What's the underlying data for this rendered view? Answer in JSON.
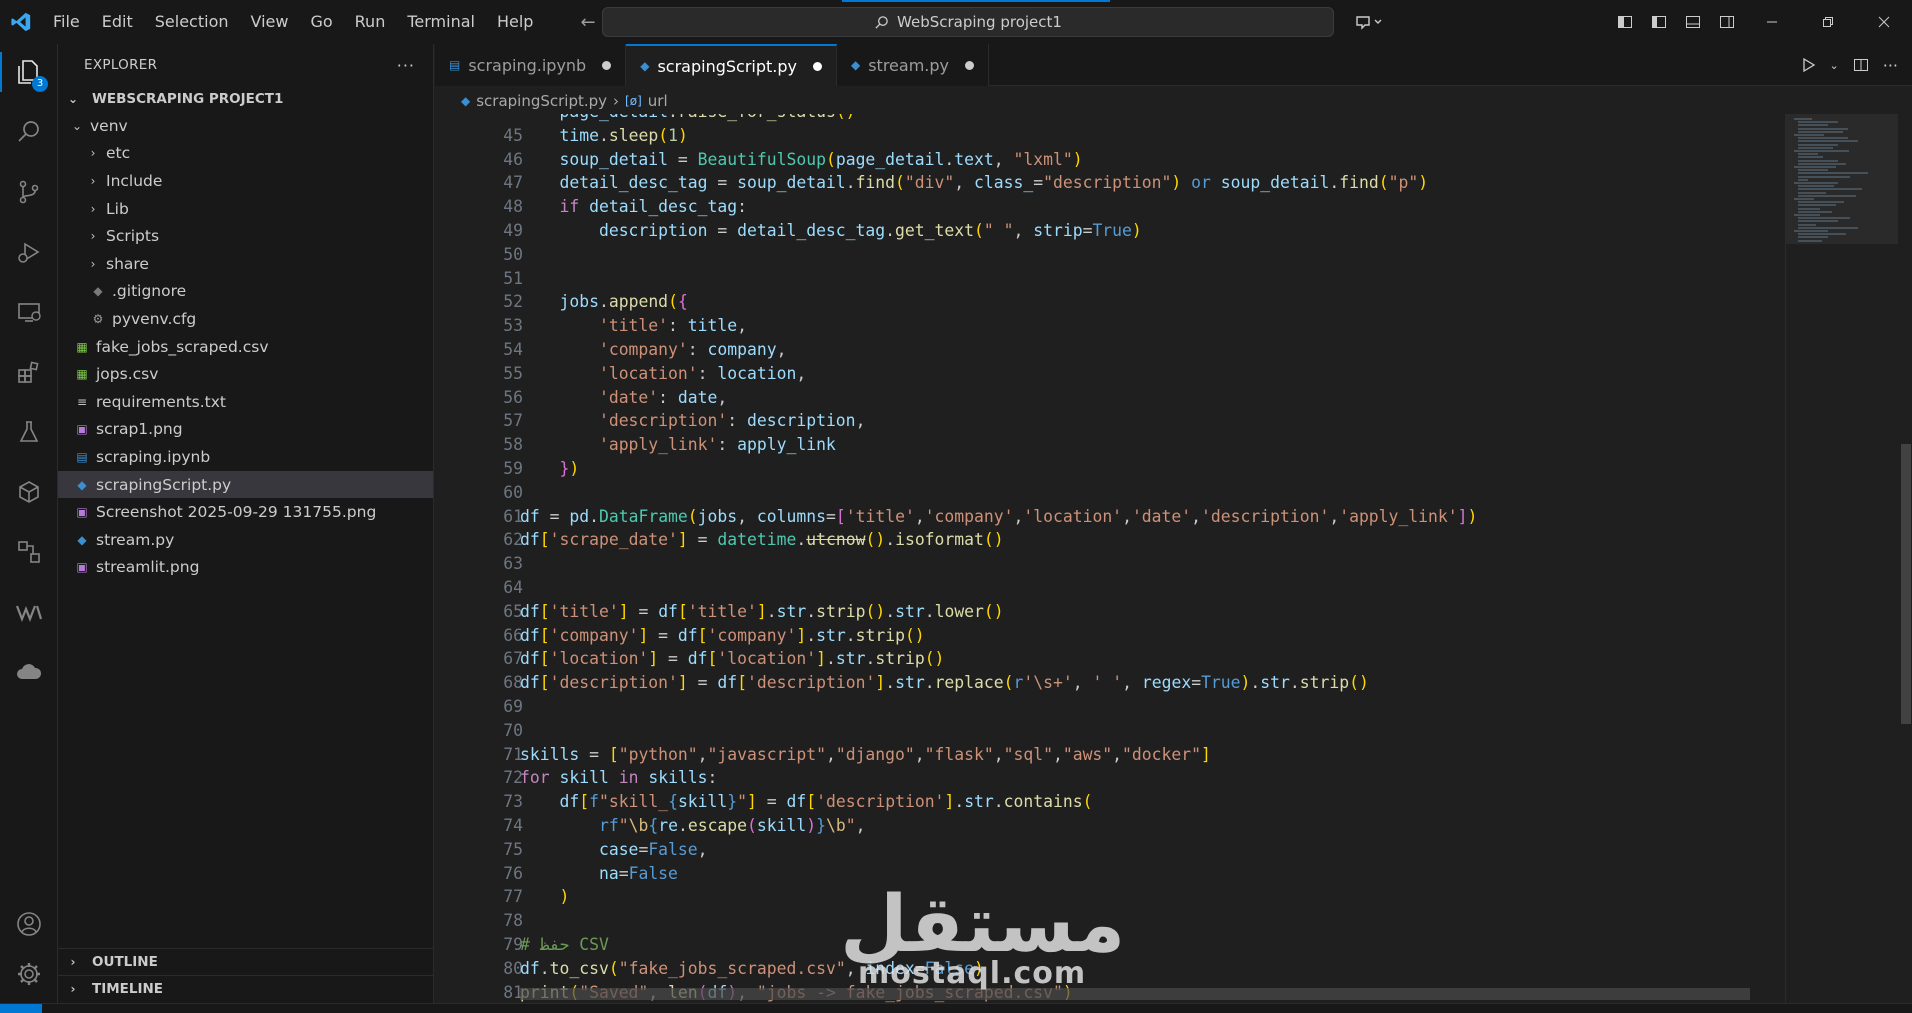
{
  "menu": [
    "File",
    "Edit",
    "Selection",
    "View",
    "Go",
    "Run",
    "Terminal",
    "Help"
  ],
  "command_center": {
    "label": "WebScraping project1"
  },
  "accent_color": "#0078d4",
  "activity_bar": {
    "items": [
      "explorer-icon",
      "search-icon",
      "source-control-icon",
      "run-debug-icon",
      "remote-explorer-icon",
      "extensions-icon",
      "testing-icon",
      "containers-icon",
      "gitlens-icon",
      "wakatime-icon",
      "cloud-icon"
    ],
    "explorer_badge": "3",
    "bottom": [
      "account-icon",
      "manage-gear-icon"
    ]
  },
  "sidebar": {
    "title": "EXPLORER",
    "project": "WEBSCRAPING PROJECT1",
    "tree": [
      {
        "label": "venv",
        "type": "folder-open",
        "depth": 1
      },
      {
        "label": "etc",
        "type": "folder",
        "depth": 2
      },
      {
        "label": "Include",
        "type": "folder",
        "depth": 2
      },
      {
        "label": "Lib",
        "type": "folder",
        "depth": 2
      },
      {
        "label": "Scripts",
        "type": "folder",
        "depth": 2
      },
      {
        "label": "share",
        "type": "folder",
        "depth": 2
      },
      {
        "label": ".gitignore",
        "type": "gitignore",
        "depth": 2
      },
      {
        "label": "pyvenv.cfg",
        "type": "config",
        "depth": 2
      },
      {
        "label": "fake_jobs_scraped.csv",
        "type": "csv",
        "depth": 1
      },
      {
        "label": "jops.csv",
        "type": "csv",
        "depth": 1
      },
      {
        "label": "requirements.txt",
        "type": "text",
        "depth": 1
      },
      {
        "label": "scrap1.png",
        "type": "image",
        "depth": 1
      },
      {
        "label": "scraping.ipynb",
        "type": "notebook",
        "depth": 1
      },
      {
        "label": "scrapingScript.py",
        "type": "python",
        "depth": 1,
        "selected": true
      },
      {
        "label": "Screenshot 2025-09-29 131755.png",
        "type": "image",
        "depth": 1
      },
      {
        "label": "stream.py",
        "type": "python",
        "depth": 1
      },
      {
        "label": "streamlit.png",
        "type": "image",
        "depth": 1
      }
    ],
    "outline": "OUTLINE",
    "timeline": "TIMELINE"
  },
  "tabs": [
    {
      "label": "scraping.ipynb",
      "icon": "notebook-icon",
      "active": false,
      "dirty": true
    },
    {
      "label": "scrapingScript.py",
      "icon": "python-icon",
      "active": true,
      "dirty": true
    },
    {
      "label": "stream.py",
      "icon": "python-icon",
      "active": false,
      "dirty": true
    }
  ],
  "breadcrumb": {
    "file": "scrapingScript.py",
    "symbol": "url"
  },
  "code": {
    "first_line": 45,
    "last_line": 81
  },
  "watermark": {
    "arabic": "مستقل",
    "latin": "mostaql.com"
  }
}
